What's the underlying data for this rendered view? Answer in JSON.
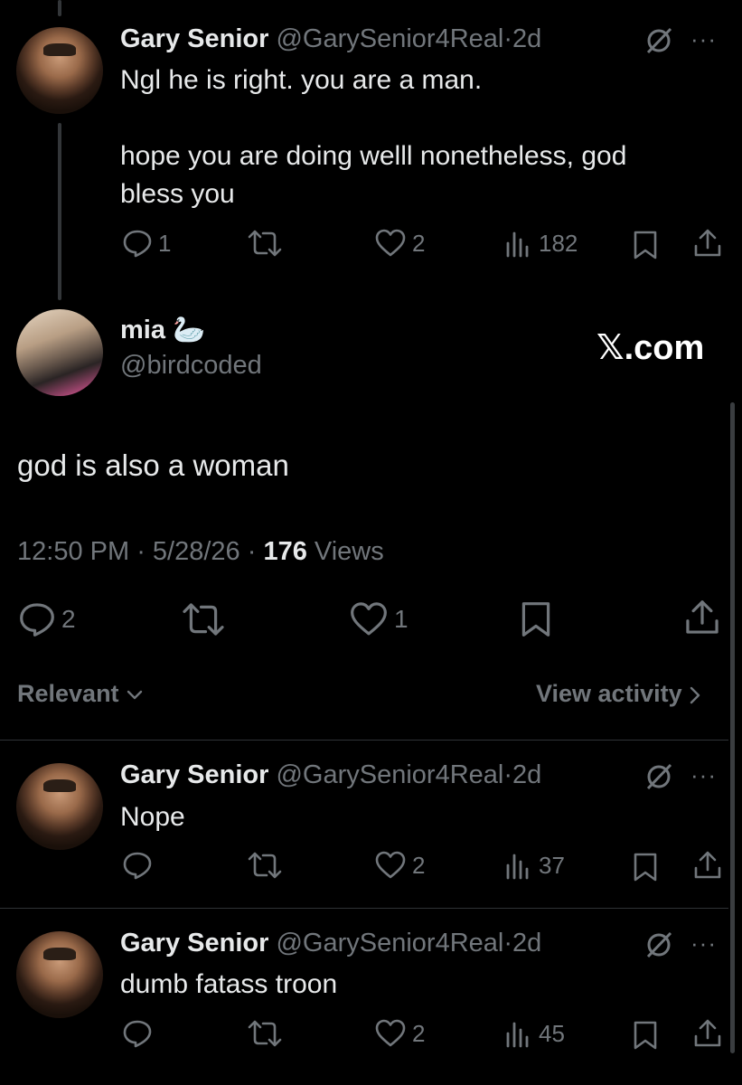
{
  "reply1": {
    "name": "Gary Senior",
    "handle": "@GarySenior4Real",
    "sep": "·",
    "age": "2d",
    "text_line1": "Ngl he is right. you are a man.",
    "text_line2": "hope you are doing welll nonetheless, god",
    "text_line3": "bless you",
    "replies": "1",
    "likes": "2",
    "views": "182"
  },
  "main": {
    "name": "mia",
    "emoji": "🦢",
    "handle": "@birdcoded",
    "watermark": "𝕏.com",
    "text": "god is also a woman",
    "time": "12:50 PM",
    "date": "5/28/26",
    "views_count": "176",
    "views_label": "Views",
    "replies": "2",
    "likes": "1"
  },
  "sort": {
    "label": "Relevant",
    "view_activity": "View activity"
  },
  "comments": [
    {
      "name": "Gary Senior",
      "handle": "@GarySenior4Real",
      "sep": "·",
      "age": "2d",
      "text": "Nope",
      "likes": "2",
      "views": "37"
    },
    {
      "name": "Gary Senior",
      "handle": "@GarySenior4Real",
      "sep": "·",
      "age": "2d",
      "text": "dumb fatass troon",
      "likes": "2",
      "views": "45"
    }
  ],
  "colors": {
    "background": "#000000",
    "text": "#e7e9ea",
    "muted": "#71767b",
    "divider": "#2f3336"
  }
}
